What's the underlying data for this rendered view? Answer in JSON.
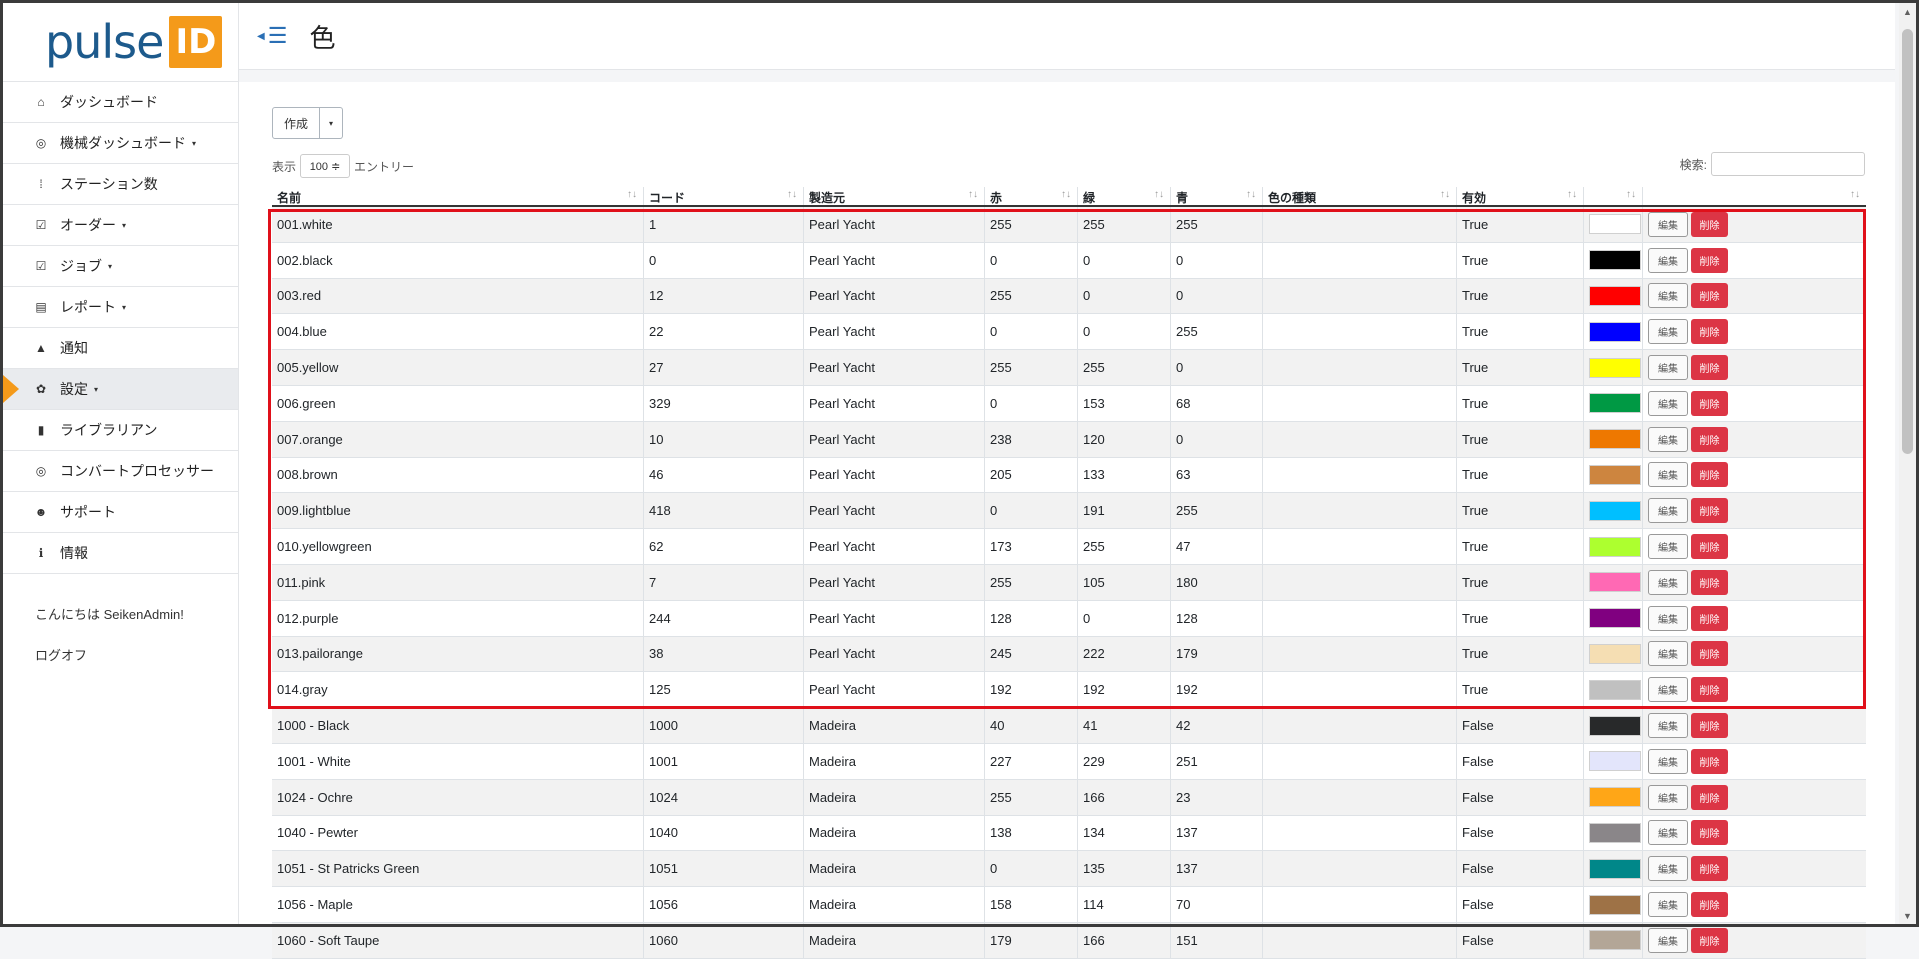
{
  "brand": {
    "word": "pulse",
    "badge": "ID"
  },
  "page_title": "色",
  "sidebar": {
    "items": [
      {
        "label": "ダッシュボード",
        "icon": "home-icon",
        "glyph": "⌂",
        "caret": false
      },
      {
        "label": "機械ダッシュボード",
        "icon": "gauge-icon",
        "glyph": "◎",
        "caret": true
      },
      {
        "label": "ステーション数",
        "icon": "stations-icon",
        "glyph": "⁞",
        "caret": false
      },
      {
        "label": "オーダー",
        "icon": "check-square-icon",
        "glyph": "☑",
        "caret": true
      },
      {
        "label": "ジョブ",
        "icon": "check-square-icon",
        "glyph": "☑",
        "caret": true
      },
      {
        "label": "レポート",
        "icon": "table-icon",
        "glyph": "▤",
        "caret": true
      },
      {
        "label": "通知",
        "icon": "bell-icon",
        "glyph": "▲",
        "caret": false
      },
      {
        "label": "設定",
        "icon": "gear-icon",
        "glyph": "✿",
        "caret": true,
        "active": true
      },
      {
        "label": "ライブラリアン",
        "icon": "book-icon",
        "glyph": "▮",
        "caret": false
      },
      {
        "label": "コンバートプロセッサー",
        "icon": "target-icon",
        "glyph": "◎",
        "caret": false
      },
      {
        "label": "サポート",
        "icon": "users-icon",
        "glyph": "☻",
        "caret": false
      },
      {
        "label": "情報",
        "icon": "info-icon",
        "glyph": "ℹ",
        "caret": false
      }
    ],
    "greeting": "こんにちは SeikenAdmin!",
    "logoff": "ログオフ"
  },
  "toolbar": {
    "create_label": "作成",
    "dropdown_caret": "▾"
  },
  "length": {
    "prefix": "表示",
    "value": "100 ≑",
    "suffix": "エントリー"
  },
  "search": {
    "label": "検索:",
    "value": ""
  },
  "table": {
    "columns": [
      "名前",
      "コード",
      "製造元",
      "赤",
      "緑",
      "青",
      "色の種類",
      "有効",
      "",
      ""
    ],
    "sort_icons": [
      "↑↓",
      "↑↓",
      "↑↓",
      "↑↓",
      "↑↓",
      "↑↓",
      "↑↓",
      "↑↓",
      "↑↓",
      "↑↓"
    ],
    "edit_label": "編集",
    "delete_label": "削除",
    "rows": [
      {
        "name": "001.white",
        "code": "1",
        "maker": "Pearl Yacht",
        "r": "255",
        "g": "255",
        "b": "255",
        "kind": "",
        "enabled": "True",
        "color": "#ffffff"
      },
      {
        "name": "002.black",
        "code": "0",
        "maker": "Pearl Yacht",
        "r": "0",
        "g": "0",
        "b": "0",
        "kind": "",
        "enabled": "True",
        "color": "#000000"
      },
      {
        "name": "003.red",
        "code": "12",
        "maker": "Pearl Yacht",
        "r": "255",
        "g": "0",
        "b": "0",
        "kind": "",
        "enabled": "True",
        "color": "#ff0000"
      },
      {
        "name": "004.blue",
        "code": "22",
        "maker": "Pearl Yacht",
        "r": "0",
        "g": "0",
        "b": "255",
        "kind": "",
        "enabled": "True",
        "color": "#0000ff"
      },
      {
        "name": "005.yellow",
        "code": "27",
        "maker": "Pearl Yacht",
        "r": "255",
        "g": "255",
        "b": "0",
        "kind": "",
        "enabled": "True",
        "color": "#ffff00"
      },
      {
        "name": "006.green",
        "code": "329",
        "maker": "Pearl Yacht",
        "r": "0",
        "g": "153",
        "b": "68",
        "kind": "",
        "enabled": "True",
        "color": "#009944"
      },
      {
        "name": "007.orange",
        "code": "10",
        "maker": "Pearl Yacht",
        "r": "238",
        "g": "120",
        "b": "0",
        "kind": "",
        "enabled": "True",
        "color": "#ee7800"
      },
      {
        "name": "008.brown",
        "code": "46",
        "maker": "Pearl Yacht",
        "r": "205",
        "g": "133",
        "b": "63",
        "kind": "",
        "enabled": "True",
        "color": "#cd853f"
      },
      {
        "name": "009.lightblue",
        "code": "418",
        "maker": "Pearl Yacht",
        "r": "0",
        "g": "191",
        "b": "255",
        "kind": "",
        "enabled": "True",
        "color": "#00bfff"
      },
      {
        "name": "010.yellowgreen",
        "code": "62",
        "maker": "Pearl Yacht",
        "r": "173",
        "g": "255",
        "b": "47",
        "kind": "",
        "enabled": "True",
        "color": "#adff2f"
      },
      {
        "name": "011.pink",
        "code": "7",
        "maker": "Pearl Yacht",
        "r": "255",
        "g": "105",
        "b": "180",
        "kind": "",
        "enabled": "True",
        "color": "#ff69b4"
      },
      {
        "name": "012.purple",
        "code": "244",
        "maker": "Pearl Yacht",
        "r": "128",
        "g": "0",
        "b": "128",
        "kind": "",
        "enabled": "True",
        "color": "#800080"
      },
      {
        "name": "013.pailorange",
        "code": "38",
        "maker": "Pearl Yacht",
        "r": "245",
        "g": "222",
        "b": "179",
        "kind": "",
        "enabled": "True",
        "color": "#f5deb3"
      },
      {
        "name": "014.gray",
        "code": "125",
        "maker": "Pearl Yacht",
        "r": "192",
        "g": "192",
        "b": "192",
        "kind": "",
        "enabled": "True",
        "color": "#c0c0c0"
      },
      {
        "name": "1000 - Black",
        "code": "1000",
        "maker": "Madeira",
        "r": "40",
        "g": "41",
        "b": "42",
        "kind": "",
        "enabled": "False",
        "color": "#28292a"
      },
      {
        "name": "1001 - White",
        "code": "1001",
        "maker": "Madeira",
        "r": "227",
        "g": "229",
        "b": "251",
        "kind": "",
        "enabled": "False",
        "color": "#e3e5fb"
      },
      {
        "name": "1024 - Ochre",
        "code": "1024",
        "maker": "Madeira",
        "r": "255",
        "g": "166",
        "b": "23",
        "kind": "",
        "enabled": "False",
        "color": "#ffa617"
      },
      {
        "name": "1040 - Pewter",
        "code": "1040",
        "maker": "Madeira",
        "r": "138",
        "g": "134",
        "b": "137",
        "kind": "",
        "enabled": "False",
        "color": "#8a8689"
      },
      {
        "name": "1051 - St Patricks Green",
        "code": "1051",
        "maker": "Madeira",
        "r": "0",
        "g": "135",
        "b": "137",
        "kind": "",
        "enabled": "False",
        "color": "#008789"
      },
      {
        "name": "1056 - Maple",
        "code": "1056",
        "maker": "Madeira",
        "r": "158",
        "g": "114",
        "b": "70",
        "kind": "",
        "enabled": "False",
        "color": "#9e7246"
      },
      {
        "name": "1060 - Soft Taupe",
        "code": "1060",
        "maker": "Madeira",
        "r": "179",
        "g": "166",
        "b": "151",
        "kind": "",
        "enabled": "False",
        "color": "#b3a697"
      }
    ]
  },
  "colors": {
    "accent": "#f49a1a",
    "brand_blue": "#1d5a8c",
    "danger": "#dc3545",
    "highlight": "#e0101a"
  }
}
